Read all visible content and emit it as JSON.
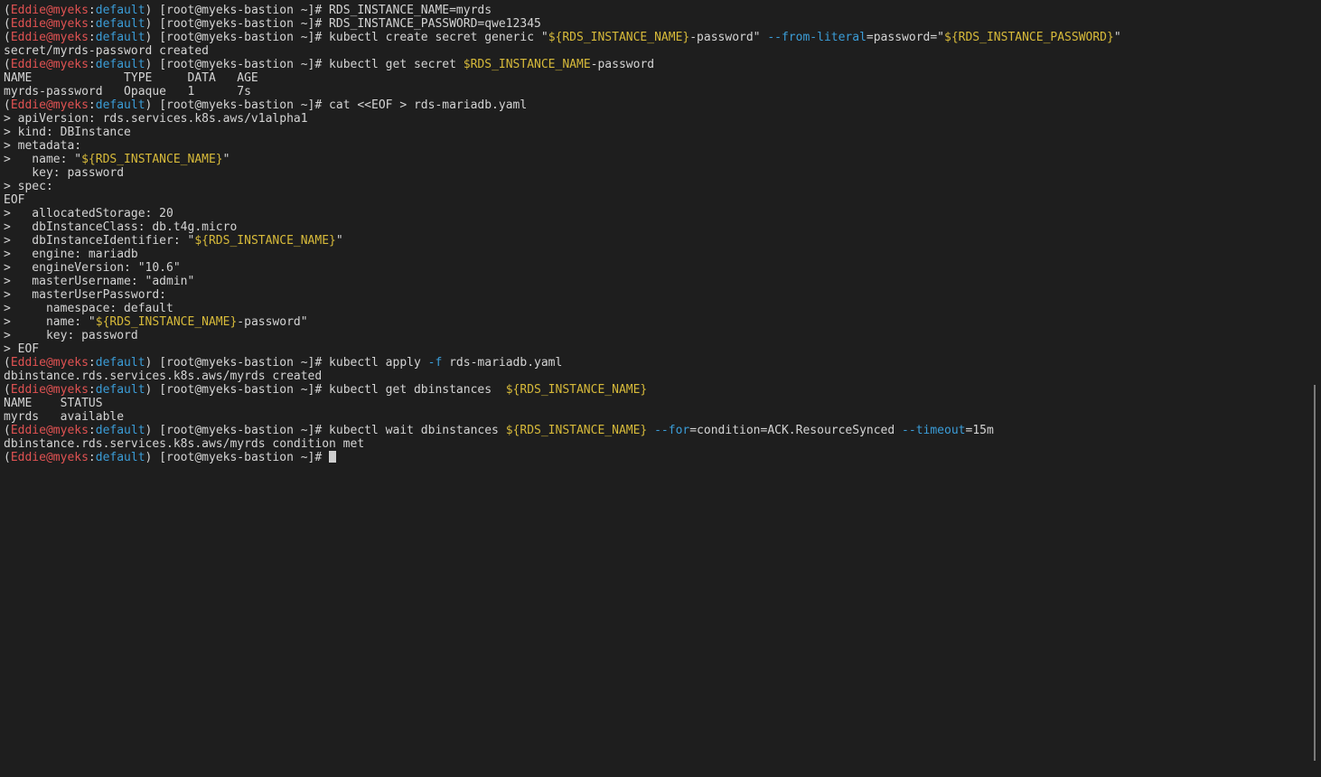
{
  "colors": {
    "background": "#1e1e1e",
    "text": "#d4d4d4",
    "user": "#e05252",
    "context": "#3b9dd8",
    "variable": "#d7ba3a",
    "flag": "#3b9dd8"
  },
  "prompt": {
    "open": "(",
    "user": "Eddie@myeks",
    "sep": ":",
    "ctx": "default",
    "close": ") [root@myeks-bastion ~]# "
  },
  "lines": [
    {
      "type": "prompt",
      "segments": [
        {
          "t": "RDS_INSTANCE_NAME=myrds",
          "c": "default"
        }
      ]
    },
    {
      "type": "prompt",
      "segments": [
        {
          "t": "RDS_INSTANCE_PASSWORD=qwe12345",
          "c": "default"
        }
      ]
    },
    {
      "type": "prompt",
      "segments": [
        {
          "t": "kubectl create secret generic \"",
          "c": "default"
        },
        {
          "t": "${RDS_INSTANCE_NAME}",
          "c": "var"
        },
        {
          "t": "-password\" ",
          "c": "default"
        },
        {
          "t": "--from-literal",
          "c": "flag"
        },
        {
          "t": "=password=\"",
          "c": "default"
        },
        {
          "t": "${RDS_INSTANCE_PASSWORD}",
          "c": "var"
        },
        {
          "t": "\"",
          "c": "default"
        }
      ]
    },
    {
      "type": "out",
      "segments": [
        {
          "t": "secret/myrds-password created",
          "c": "default"
        }
      ]
    },
    {
      "type": "prompt",
      "segments": [
        {
          "t": "kubectl get secret ",
          "c": "default"
        },
        {
          "t": "$RDS_INSTANCE_NAME",
          "c": "var"
        },
        {
          "t": "-password",
          "c": "default"
        }
      ]
    },
    {
      "type": "out",
      "segments": [
        {
          "t": "NAME             TYPE     DATA   AGE",
          "c": "default"
        }
      ]
    },
    {
      "type": "out",
      "segments": [
        {
          "t": "myrds-password   Opaque   1      7s",
          "c": "default"
        }
      ]
    },
    {
      "type": "prompt",
      "segments": [
        {
          "t": "cat <<EOF > rds-mariadb.yaml",
          "c": "default"
        }
      ]
    },
    {
      "type": "out",
      "segments": [
        {
          "t": "> apiVersion: rds.services.k8s.aws/v1alpha1",
          "c": "default"
        }
      ]
    },
    {
      "type": "out",
      "segments": [
        {
          "t": "> kind: DBInstance",
          "c": "default"
        }
      ]
    },
    {
      "type": "out",
      "segments": [
        {
          "t": "> metadata:",
          "c": "default"
        }
      ]
    },
    {
      "type": "out",
      "segments": [
        {
          "t": ">   name: \"",
          "c": "default"
        },
        {
          "t": "${RDS_INSTANCE_NAME}",
          "c": "var"
        },
        {
          "t": "\"",
          "c": "default"
        }
      ]
    },
    {
      "type": "out",
      "segments": [
        {
          "t": "    key: password",
          "c": "default"
        }
      ]
    },
    {
      "type": "out",
      "segments": [
        {
          "t": "> spec:",
          "c": "default"
        }
      ]
    },
    {
      "type": "out",
      "segments": [
        {
          "t": "EOF",
          "c": "default"
        }
      ]
    },
    {
      "type": "out",
      "segments": [
        {
          "t": ">   allocatedStorage: 20",
          "c": "default"
        }
      ]
    },
    {
      "type": "out",
      "segments": [
        {
          "t": ">   dbInstanceClass: db.t4g.micro",
          "c": "default"
        }
      ]
    },
    {
      "type": "out",
      "segments": [
        {
          "t": ">   dbInstanceIdentifier: \"",
          "c": "default"
        },
        {
          "t": "${RDS_INSTANCE_NAME}",
          "c": "var"
        },
        {
          "t": "\"",
          "c": "default"
        }
      ]
    },
    {
      "type": "out",
      "segments": [
        {
          "t": ">   engine: mariadb",
          "c": "default"
        }
      ]
    },
    {
      "type": "out",
      "segments": [
        {
          "t": ">   engineVersion: \"10.6\"",
          "c": "default"
        }
      ]
    },
    {
      "type": "out",
      "segments": [
        {
          "t": ">   masterUsername: \"admin\"",
          "c": "default"
        }
      ]
    },
    {
      "type": "out",
      "segments": [
        {
          "t": ">   masterUserPassword:",
          "c": "default"
        }
      ]
    },
    {
      "type": "out",
      "segments": [
        {
          "t": ">     namespace: default",
          "c": "default"
        }
      ]
    },
    {
      "type": "out",
      "segments": [
        {
          "t": ">     name: \"",
          "c": "default"
        },
        {
          "t": "${RDS_INSTANCE_NAME}",
          "c": "var"
        },
        {
          "t": "-password\"",
          "c": "default"
        }
      ]
    },
    {
      "type": "out",
      "segments": [
        {
          "t": ">     key: password",
          "c": "default"
        }
      ]
    },
    {
      "type": "out",
      "segments": [
        {
          "t": "> EOF",
          "c": "default"
        }
      ]
    },
    {
      "type": "prompt",
      "segments": [
        {
          "t": "kubectl apply ",
          "c": "default"
        },
        {
          "t": "-f",
          "c": "flag"
        },
        {
          "t": " rds-mariadb.yaml",
          "c": "default"
        }
      ]
    },
    {
      "type": "out",
      "segments": [
        {
          "t": "dbinstance.rds.services.k8s.aws/myrds created",
          "c": "default"
        }
      ]
    },
    {
      "type": "prompt",
      "segments": [
        {
          "t": "kubectl get dbinstances  ",
          "c": "default"
        },
        {
          "t": "${RDS_INSTANCE_NAME}",
          "c": "var"
        }
      ]
    },
    {
      "type": "out",
      "segments": [
        {
          "t": "NAME    STATUS",
          "c": "default"
        }
      ]
    },
    {
      "type": "out",
      "segments": [
        {
          "t": "myrds   available",
          "c": "default"
        }
      ]
    },
    {
      "type": "prompt",
      "segments": [
        {
          "t": "kubectl wait dbinstances ",
          "c": "default"
        },
        {
          "t": "${RDS_INSTANCE_NAME}",
          "c": "var"
        },
        {
          "t": " ",
          "c": "default"
        },
        {
          "t": "--for",
          "c": "flag"
        },
        {
          "t": "=condition=ACK.ResourceSynced ",
          "c": "default"
        },
        {
          "t": "--timeout",
          "c": "flag"
        },
        {
          "t": "=15m",
          "c": "default"
        }
      ]
    },
    {
      "type": "out",
      "segments": [
        {
          "t": "dbinstance.rds.services.k8s.aws/myrds condition met",
          "c": "default"
        }
      ]
    },
    {
      "type": "prompt",
      "cursor": true,
      "segments": []
    }
  ]
}
